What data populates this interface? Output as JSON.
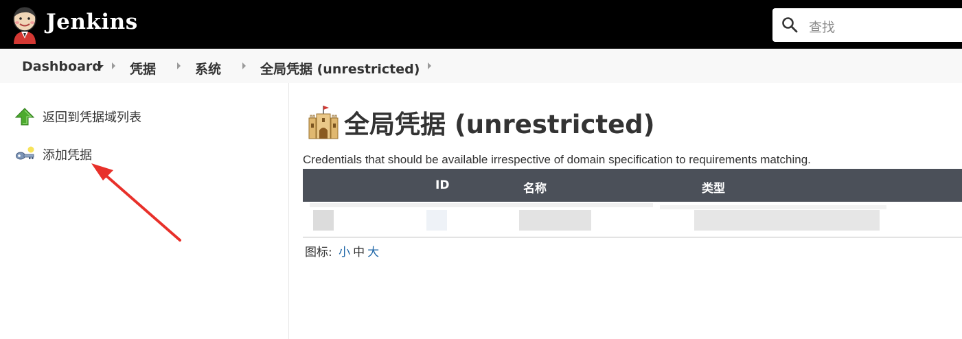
{
  "header": {
    "brand": "Jenkins",
    "search_placeholder": "查找"
  },
  "breadcrumb": {
    "items": [
      "Dashboard",
      "凭据",
      "系统",
      "全局凭据 (unrestricted)"
    ]
  },
  "sidebar": {
    "tasks": [
      {
        "label": "返回到凭据域列表",
        "icon": "up-arrow-icon"
      },
      {
        "label": "添加凭据",
        "icon": "key-icon"
      }
    ]
  },
  "main": {
    "title": "全局凭据 (unrestricted)",
    "description": "Credentials that should be available irrespective of domain specification to requirements matching.",
    "table": {
      "columns": [
        "ID",
        "名称",
        "类型"
      ]
    },
    "icon_size": {
      "label": "图标:",
      "options": [
        "小",
        "中",
        "大"
      ]
    }
  },
  "colors": {
    "header_bg": "#000000",
    "table_header_bg": "#4b5059",
    "link": "#2168a8",
    "annotation_arrow": "#e8302a"
  }
}
